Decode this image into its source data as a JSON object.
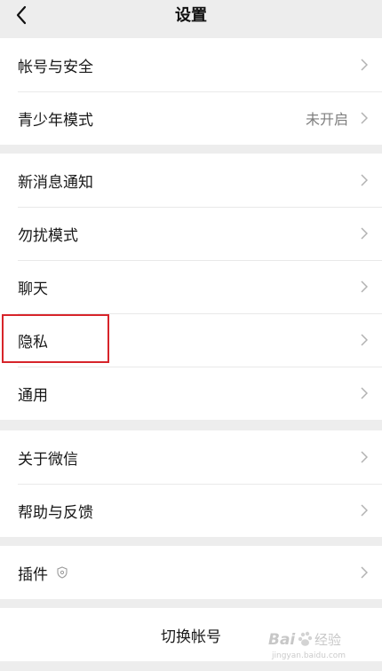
{
  "nav": {
    "title": "设置",
    "back_icon": "chevron-left-icon"
  },
  "groups": [
    {
      "items": [
        {
          "label": "帐号与安全",
          "value": ""
        },
        {
          "label": "青少年模式",
          "value": "未开启"
        }
      ]
    },
    {
      "items": [
        {
          "label": "新消息通知",
          "value": ""
        },
        {
          "label": "勿扰模式",
          "value": ""
        },
        {
          "label": "聊天",
          "value": ""
        },
        {
          "label": "隐私",
          "value": ""
        },
        {
          "label": "通用",
          "value": ""
        }
      ]
    },
    {
      "items": [
        {
          "label": "关于微信",
          "value": ""
        },
        {
          "label": "帮助与反馈",
          "value": ""
        }
      ]
    },
    {
      "items": [
        {
          "label": "插件",
          "value": "",
          "icon": "shield-icon"
        }
      ]
    }
  ],
  "switch_account": {
    "label": "切换帐号"
  },
  "highlight": {
    "target": "隐私",
    "color": "#d7242a"
  },
  "watermark": {
    "brand": "Bai",
    "suffix": "经验",
    "sub": "jingyan.baidu.com"
  }
}
